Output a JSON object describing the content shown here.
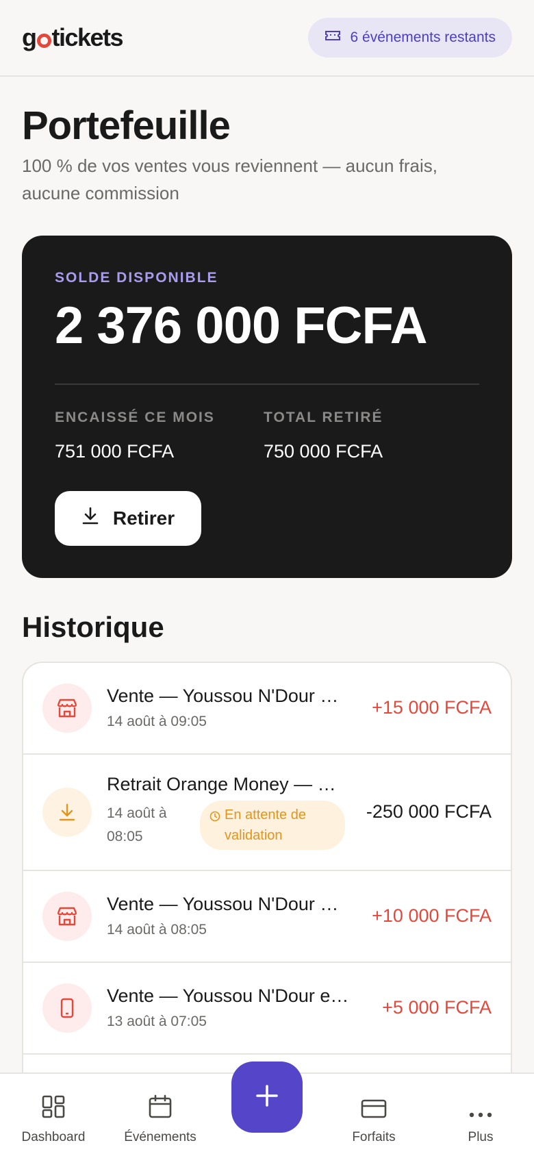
{
  "header": {
    "logo_prefix": "g",
    "logo_suffix": "tickets",
    "events_left": "6 événements restants"
  },
  "page": {
    "title": "Portefeuille",
    "subtitle": "100 % de vos ventes vous reviennent — aucun frais, aucune commission"
  },
  "balance": {
    "label": "SOLDE DISPONIBLE",
    "amount": "2 376 000 FCFA",
    "month_label": "ENCAISSÉ CE MOIS",
    "month_value": "751 000 FCFA",
    "withdrawn_label": "TOTAL RETIRÉ",
    "withdrawn_value": "750 000 FCFA",
    "withdraw_button": "Retirer"
  },
  "history": {
    "title": "Historique",
    "items": [
      {
        "title": "Vente — Youssou N'Dour …",
        "date": "14 août à 09:05",
        "amount": "+15 000 FCFA",
        "icon": "store-icon"
      },
      {
        "title": "Retrait Orange Money — …",
        "date": "14 août à 08:05",
        "amount": "-250 000 FCFA",
        "icon": "download-icon",
        "status": "En attente de validation"
      },
      {
        "title": "Vente — Youssou N'Dour …",
        "date": "14 août à 08:05",
        "amount": "+10 000 FCFA",
        "icon": "store-icon"
      },
      {
        "title": "Vente — Youssou N'Dour e…",
        "date": "13 août à 07:05",
        "amount": "+5 000 FCFA",
        "icon": "phone-icon"
      }
    ]
  },
  "nav": {
    "dashboard": "Dashboard",
    "events": "Événements",
    "plans": "Forfaits",
    "more": "Plus"
  },
  "colors": {
    "accent": "#5545c8",
    "positive": "#e5483b",
    "pending": "#e3941c",
    "card": "#1a1a1a"
  }
}
